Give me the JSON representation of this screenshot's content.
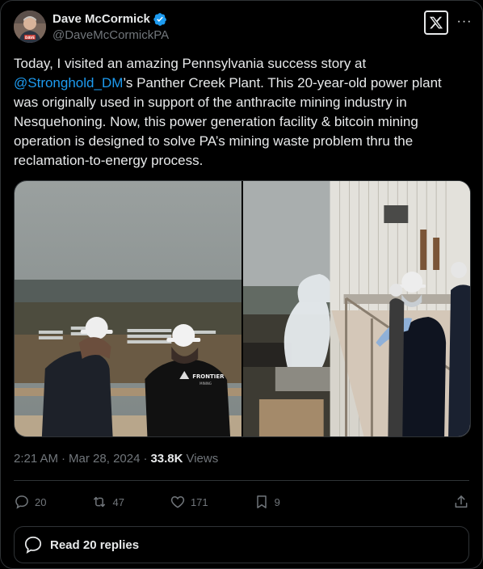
{
  "author": {
    "display_name": "Dave McCormick",
    "handle": "@DaveMcCormickPA",
    "avatar_icon": "avatar-photo",
    "avatar_badge_text": "DAVE",
    "verified": true
  },
  "header_icons": {
    "x_logo": "x-logo-icon",
    "more": "more-options-icon",
    "more_glyph": "···"
  },
  "tweet": {
    "text_before_mention": "Today, I visited an amazing Pennsylvania success story at ",
    "mention": "@Stronghold_DM",
    "text_after_mention": "’s Panther Creek Plant. This 20-year-old power plant was originally used in support of the anthracite mining industry in Nesquehoning. Now, this power generation facility & bitcoin mining operation is designed to solve PA’s mining waste problem thru the reclamation-to-energy process."
  },
  "media": {
    "photos": [
      {
        "name": "photo-overlook",
        "shirt_text": "FRONTIER",
        "shirt_subtext": "MINING"
      },
      {
        "name": "photo-cooling-tower"
      }
    ]
  },
  "meta": {
    "time": "2:21 AM",
    "date": "Mar 28, 2024",
    "separator": "·",
    "views_count": "33.8K",
    "views_label": "Views"
  },
  "actions": {
    "replies": "20",
    "reposts": "47",
    "likes": "171",
    "bookmarks": "9"
  },
  "read_replies_label": "Read 20 replies",
  "colors": {
    "background": "#000000",
    "text": "#e7e9ea",
    "muted": "#71767b",
    "accent": "#1d9bf0",
    "border": "#2f3336"
  }
}
